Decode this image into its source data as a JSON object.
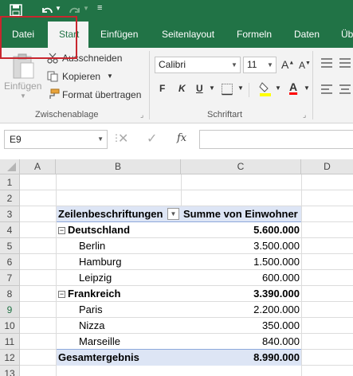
{
  "tabs": [
    "Datei",
    "Start",
    "Einfügen",
    "Seitenlayout",
    "Formeln",
    "Daten",
    "Üb"
  ],
  "ribbon": {
    "paste_label": "Einfügen",
    "cut_label": "Ausschneiden",
    "copy_label": "Kopieren",
    "format_painter_label": "Format übertragen",
    "clipboard_group": "Zwischenablage",
    "font_name": "Calibri",
    "font_size": "11",
    "bold": "F",
    "italic": "K",
    "underline": "U",
    "font_group": "Schriftart",
    "grow_font": "A",
    "shrink_font": "A",
    "fill_color": "#ffff00",
    "font_color": "#ff0000"
  },
  "formula_bar": {
    "name_box": "E9",
    "fx": "fx",
    "value": ""
  },
  "columns": [
    "A",
    "B",
    "C",
    "D"
  ],
  "rows": [
    "1",
    "2",
    "3",
    "4",
    "5",
    "6",
    "7",
    "8",
    "9",
    "10",
    "11",
    "12",
    "13"
  ],
  "pivot": {
    "header_row_labels": "Zeilenbeschriftungen",
    "header_values": "Summe von Einwohner",
    "items": [
      {
        "label": "Deutschland",
        "value": "5.600.000",
        "level": 0
      },
      {
        "label": "Berlin",
        "value": "3.500.000",
        "level": 1
      },
      {
        "label": "Hamburg",
        "value": "1.500.000",
        "level": 1
      },
      {
        "label": "Leipzig",
        "value": "600.000",
        "level": 1
      },
      {
        "label": "Frankreich",
        "value": "3.390.000",
        "level": 0
      },
      {
        "label": "Paris",
        "value": "2.200.000",
        "level": 1
      },
      {
        "label": "Nizza",
        "value": "350.000",
        "level": 1
      },
      {
        "label": "Marseille",
        "value": "840.000",
        "level": 1
      }
    ],
    "total_label": "Gesamtergebnis",
    "total_value": "8.990.000"
  },
  "colors": {
    "excel_green": "#217346",
    "highlight_red": "#c8262e",
    "pivot_header_blue": "#dde5f5"
  }
}
